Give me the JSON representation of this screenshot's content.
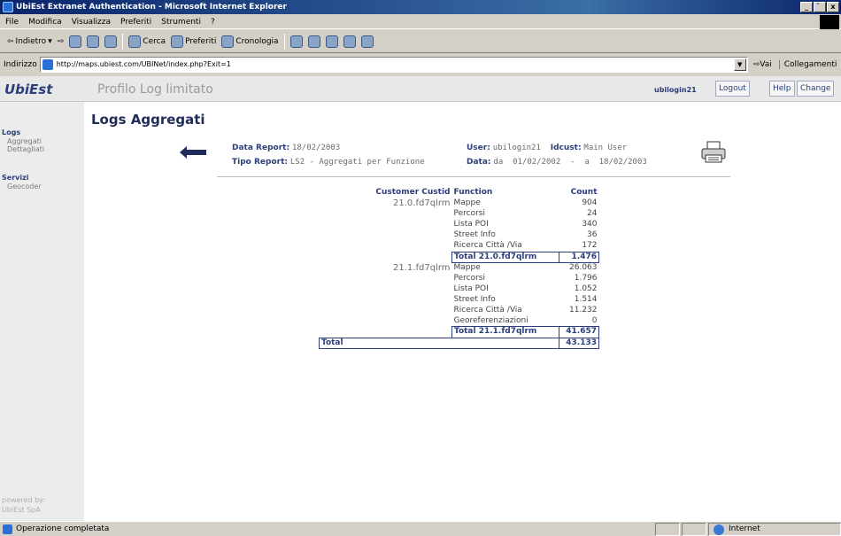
{
  "window": {
    "title": "UbiEst Extranet Authentication - Microsoft Internet Explorer",
    "controls": [
      "_",
      "̈",
      "x"
    ]
  },
  "menubar": {
    "items": [
      "File",
      "Modifica",
      "Visualizza",
      "Preferiti",
      "Strumenti",
      "?"
    ]
  },
  "toolbar": {
    "back": "Indietro",
    "search": "Cerca",
    "favorites": "Preferiti",
    "history": "Cronologia"
  },
  "address": {
    "label": "Indirizzo",
    "url": "http://maps.ubiest.com/UBINet/index.php?Exit=1",
    "go": "Vai",
    "links": "Collegamenti"
  },
  "app": {
    "brand": "UbiEst",
    "page_title": "Profilo Log limitato",
    "user": "ubilogin21",
    "buttons": [
      "Logout",
      "Help",
      "Change"
    ]
  },
  "sidebar": {
    "sections": [
      {
        "title": "Logs",
        "items": [
          "Aggregati",
          "Dettagliati"
        ]
      },
      {
        "title": "Servizi",
        "items": [
          "Geocoder"
        ]
      }
    ],
    "footer": [
      "powered by:",
      "UbiEst SpA"
    ]
  },
  "report": {
    "heading": "Logs Aggregati",
    "data_report_label": "Data Report:",
    "data_report_value": "18/02/2003",
    "tipo_report_label": "Tipo Report:",
    "tipo_report_value": "LS2 - Aggregati per Funzione",
    "user_label": "User:",
    "user_value": "ubilogin21",
    "idcust_label": "Idcust:",
    "idcust_value": "Main User",
    "data_label": "Data:",
    "data_value": "da  01/02/2002  -  a  18/02/2003"
  },
  "table": {
    "headers": [
      "Customer Custid",
      "Function",
      "Count"
    ],
    "groups": [
      {
        "custid": "21.0.fd7qlrm",
        "rows": [
          {
            "fn": "Mappe",
            "count": "904"
          },
          {
            "fn": "Percorsi",
            "count": "24"
          },
          {
            "fn": "Lista POI",
            "count": "340"
          },
          {
            "fn": "Street Info",
            "count": "36"
          },
          {
            "fn": "Ricerca Città /Via",
            "count": "172"
          }
        ],
        "total_label": "Total  21.0.fd7qlrm",
        "total": "1.476"
      },
      {
        "custid": "21.1.fd7qlrm",
        "rows": [
          {
            "fn": "Mappe",
            "count": "26.063"
          },
          {
            "fn": "Percorsi",
            "count": "1.796"
          },
          {
            "fn": "Lista POI",
            "count": "1.052"
          },
          {
            "fn": "Street Info",
            "count": "1.514"
          },
          {
            "fn": "Ricerca Città /Via",
            "count": "11.232"
          },
          {
            "fn": "Georeferenziazioni",
            "count": "0"
          }
        ],
        "total_label": "Total  21.1.fd7qlrm",
        "total": "41.657"
      }
    ],
    "grand_total_label": "Total",
    "grand_total": "43.133"
  },
  "statusbar": {
    "message": "Operazione completata",
    "zone": "Internet"
  }
}
